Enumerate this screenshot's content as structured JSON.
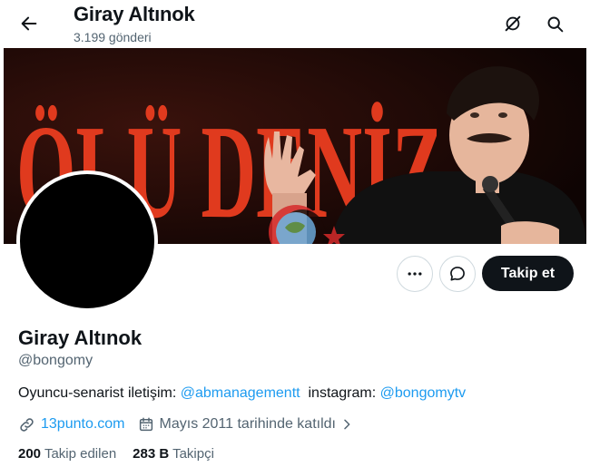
{
  "header": {
    "title": "Giray Altınok",
    "post_count": "3.199 gönderi"
  },
  "banner": {
    "text": "ÖLÜ DENİZ",
    "colors": {
      "accent_red": "#e03a1e",
      "background": "#1a0806"
    }
  },
  "actions": {
    "follow_label": "Takip et"
  },
  "profile": {
    "name": "Giray Altınok",
    "handle": "@bongomy",
    "bio": {
      "prefix": "Oyuncu-senarist iletişim: ",
      "mention1": "@abmanagementt",
      "middle": "  instagram: ",
      "mention2": "@bongomytv"
    },
    "website": "13punto.com",
    "joined": "Mayıs 2011 tarihinde katıldı"
  },
  "stats": {
    "following_count": "200",
    "following_label": "Takip edilen",
    "followers_count": "283 B",
    "followers_label": "Takipçi"
  },
  "icons": [
    "back-arrow-icon",
    "grok-icon",
    "search-icon",
    "more-icon",
    "message-icon",
    "link-icon",
    "calendar-icon",
    "chevron-right-icon"
  ],
  "theme": {
    "link_color": "#1d9bf0",
    "text_secondary": "#536471",
    "button_dark": "#0f1419"
  }
}
